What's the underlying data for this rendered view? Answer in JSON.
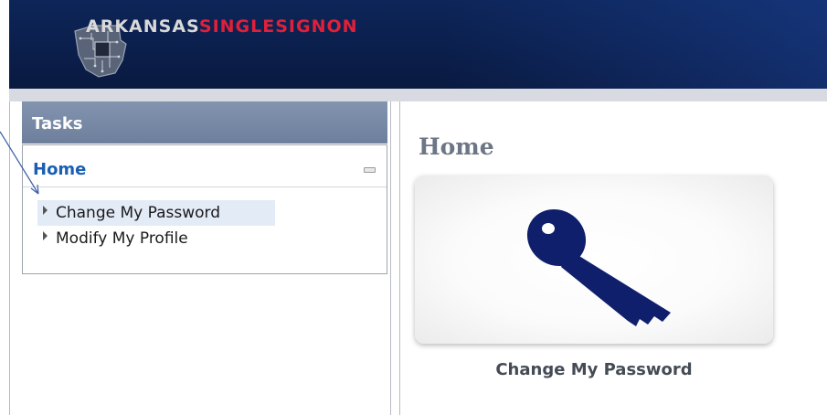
{
  "header": {
    "brand_part1": "ARKANSAS",
    "brand_part2": "SINGLESIGNON",
    "brand_color_main": "#d9d9d9",
    "brand_color_accent": "#e0203a",
    "emblem_icon": "circuit-state-icon"
  },
  "sidebar": {
    "title": "Tasks",
    "section": "Home",
    "collapse_icon": "minus-icon",
    "items": [
      {
        "label": "Change My Password",
        "icon": "triangle-right-icon",
        "highlighted": true
      },
      {
        "label": "Modify My Profile",
        "icon": "triangle-right-icon",
        "highlighted": false
      }
    ]
  },
  "main": {
    "title": "Home",
    "tiles": [
      {
        "label": "Change My Password",
        "icon": "key-icon"
      }
    ]
  },
  "colors": {
    "header_bg": "#0d2558",
    "tasks_header_bg": "#7587a3",
    "section_link": "#1a5fb4",
    "highlight": "#e3ebf7",
    "key": "#0f1f6b"
  }
}
